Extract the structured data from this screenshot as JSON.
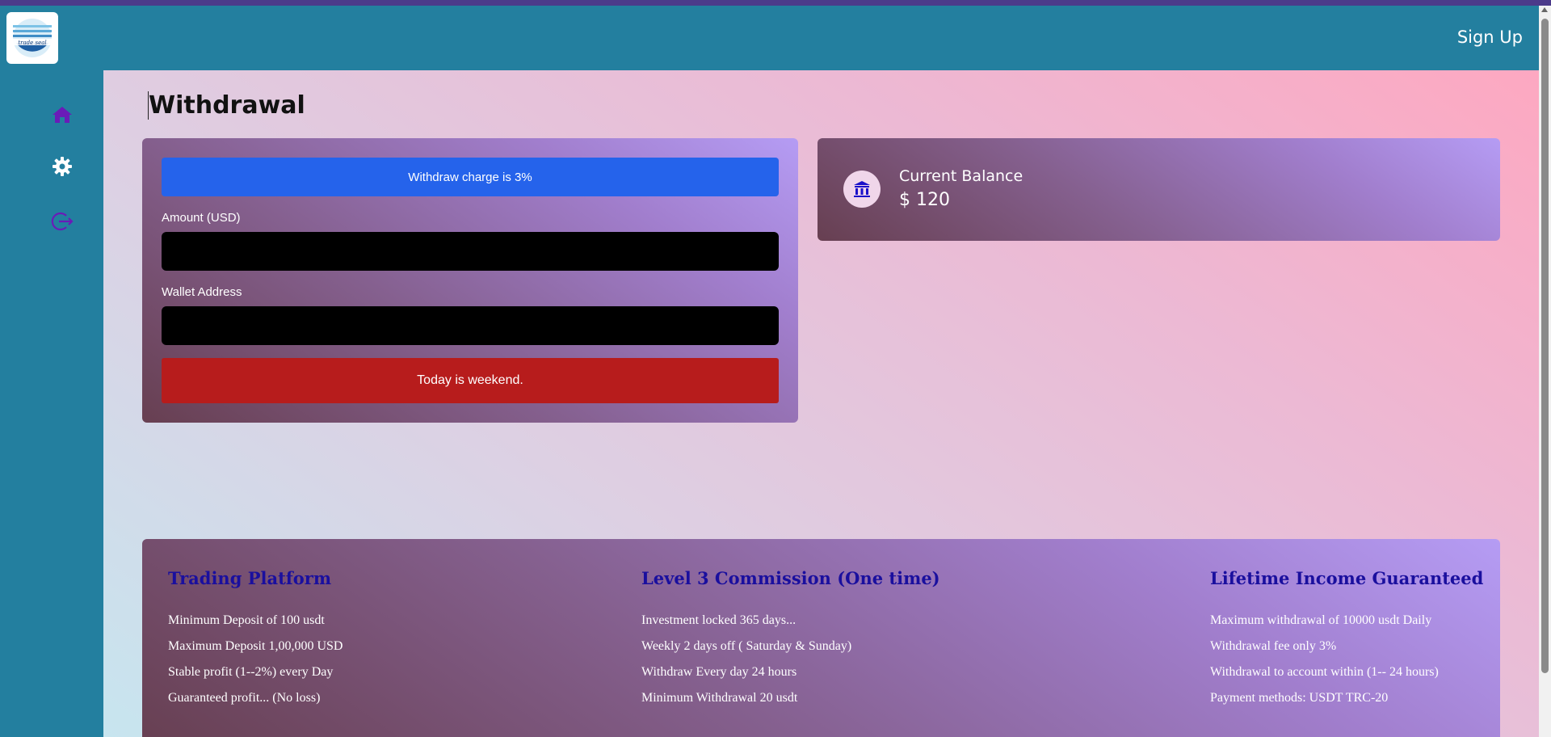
{
  "header": {
    "logo_text": "trade seal",
    "signup_label": "Sign Up"
  },
  "sidebar": {
    "items": [
      {
        "icon": "home-icon"
      },
      {
        "icon": "gear-icon"
      },
      {
        "icon": "logout-icon"
      }
    ],
    "icon_color": "#6a1bb8"
  },
  "page": {
    "title": "Withdrawal"
  },
  "form": {
    "charge_notice": "Withdraw charge is 3%",
    "amount_label": "Amount (USD)",
    "amount_value": "",
    "wallet_label": "Wallet Address",
    "wallet_value": "",
    "submit_label": "Today is weekend."
  },
  "balance": {
    "icon": "bank-icon",
    "label": "Current Balance",
    "value": "$ 120"
  },
  "info": {
    "columns": [
      {
        "title": "Trading Platform",
        "items": [
          "Minimum Deposit of 100 usdt",
          "Maximum Deposit 1,00,000 USD",
          "Stable profit (1--2%) every Day",
          "Guaranteed profit... (No loss)"
        ]
      },
      {
        "title": "Level 3 Commission (One time)",
        "items": [
          "Investment locked 365 days...",
          "Weekly 2 days off ( Saturday & Sunday)",
          "Withdraw Every day 24 hours",
          "Minimum Withdrawal 20 usdt"
        ]
      },
      {
        "title": "Lifetime Income Guaranteed",
        "items": [
          "Maximum withdrawal of 10000 usdt Daily",
          "Withdrawal fee only 3%",
          "Withdrawal to account within (1-- 24 hours)",
          "Payment methods: USDT TRC-20"
        ]
      }
    ]
  },
  "colors": {
    "header_bg": "#237f9f",
    "charge_bg": "#2563eb",
    "weekend_bg": "#b71c1c",
    "info_title": "#1a0f9e"
  }
}
